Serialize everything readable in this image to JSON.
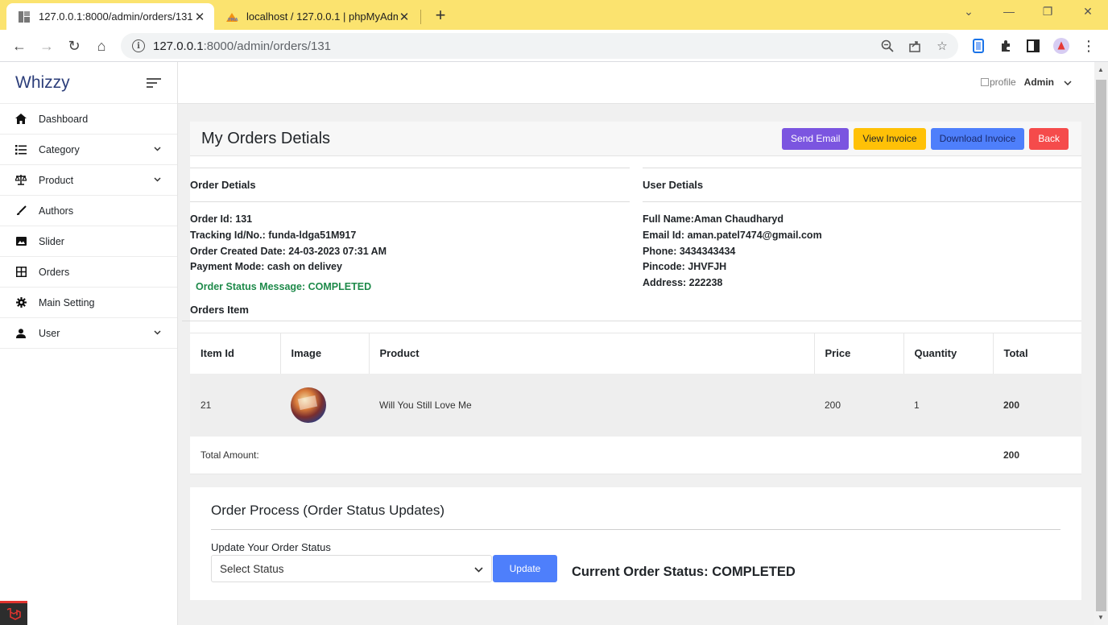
{
  "browser": {
    "tabs": [
      {
        "title": "127.0.0.1:8000/admin/orders/131",
        "active": true
      },
      {
        "title": "localhost / 127.0.0.1 | phpMyAdmin",
        "active": false
      }
    ],
    "url_host": "127.0.0.1",
    "url_path": ":8000/admin/orders/131"
  },
  "sidebar": {
    "brand": "Whizzy",
    "items": [
      {
        "label": "Dashboard",
        "icon": "home-icon",
        "has_submenu": false
      },
      {
        "label": "Category",
        "icon": "list-icon",
        "has_submenu": true
      },
      {
        "label": "Product",
        "icon": "scale-icon",
        "has_submenu": true
      },
      {
        "label": "Authors",
        "icon": "brush-icon",
        "has_submenu": false
      },
      {
        "label": "Slider",
        "icon": "image-icon",
        "has_submenu": false
      },
      {
        "label": "Orders",
        "icon": "grid-icon",
        "has_submenu": false
      },
      {
        "label": "Main Setting",
        "icon": "gear-icon",
        "has_submenu": false
      },
      {
        "label": "User",
        "icon": "user-icon",
        "has_submenu": true
      }
    ]
  },
  "topbar": {
    "profile_alt": "profile",
    "user_name": "Admin"
  },
  "page": {
    "title": "My Orders Detials",
    "buttons": {
      "send_email": "Send Email",
      "view_invoice": "View Invoice",
      "download_invoice": "Download Invoice",
      "back": "Back"
    }
  },
  "order_details": {
    "heading": "Order Detials",
    "order_id": "Order Id: 131",
    "tracking": "Tracking Id/No.: funda-ldga51M917",
    "created": "Order Created Date: 24-03-2023 07:31 AM",
    "payment": "Payment Mode: cash on delivey",
    "status_message": "Order Status Message: COMPLETED"
  },
  "user_details": {
    "heading": "User Detials",
    "full_name": "Full Name:Aman Chaudharyd",
    "email": "Email Id: aman.patel7474@gmail.com",
    "phone": "Phone: 3434343434",
    "pincode": "Pincode: JHVFJH",
    "address": "Address: 222238"
  },
  "items": {
    "heading": "Orders Item",
    "columns": [
      "Item Id",
      "Image",
      "Product",
      "Price",
      "Quantity",
      "Total"
    ],
    "rows": [
      {
        "item_id": "21",
        "product": "Will You Still Love Me",
        "price": "200",
        "quantity": "1",
        "total": "200"
      }
    ],
    "total_label": "Total Amount:",
    "total_value": "200"
  },
  "process": {
    "title": "Order Process (Order Status Updates)",
    "label": "Update Your Order Status",
    "select_value": "Select Status",
    "update_button": "Update",
    "current_status": "Current Order Status: COMPLETED"
  },
  "colors": {
    "tabbar": "#fbe36f",
    "brand": "#2c3e7a",
    "send_email": "#7b55e0",
    "view_invoice": "#ffc107",
    "download_invoice": "#4e7ffb",
    "back": "#f54b4b",
    "status_green": "#1e8a4a"
  }
}
